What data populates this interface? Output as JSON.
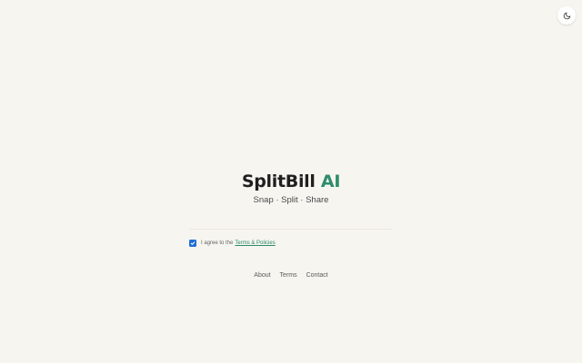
{
  "header": {
    "theme_toggle_icon": "moon-icon"
  },
  "hero": {
    "title_main": "SplitBill",
    "title_accent": "AI",
    "tagline": "Snap · Split · Share"
  },
  "consent": {
    "checked": true,
    "text": "I agree to the",
    "link_text": "Terms & Policies"
  },
  "footer": {
    "links": [
      "About",
      "Terms",
      "Contact"
    ]
  },
  "colors": {
    "background": "#f7f5f0",
    "accent": "#2e8b6a",
    "checkbox": "#1f6fd6"
  }
}
